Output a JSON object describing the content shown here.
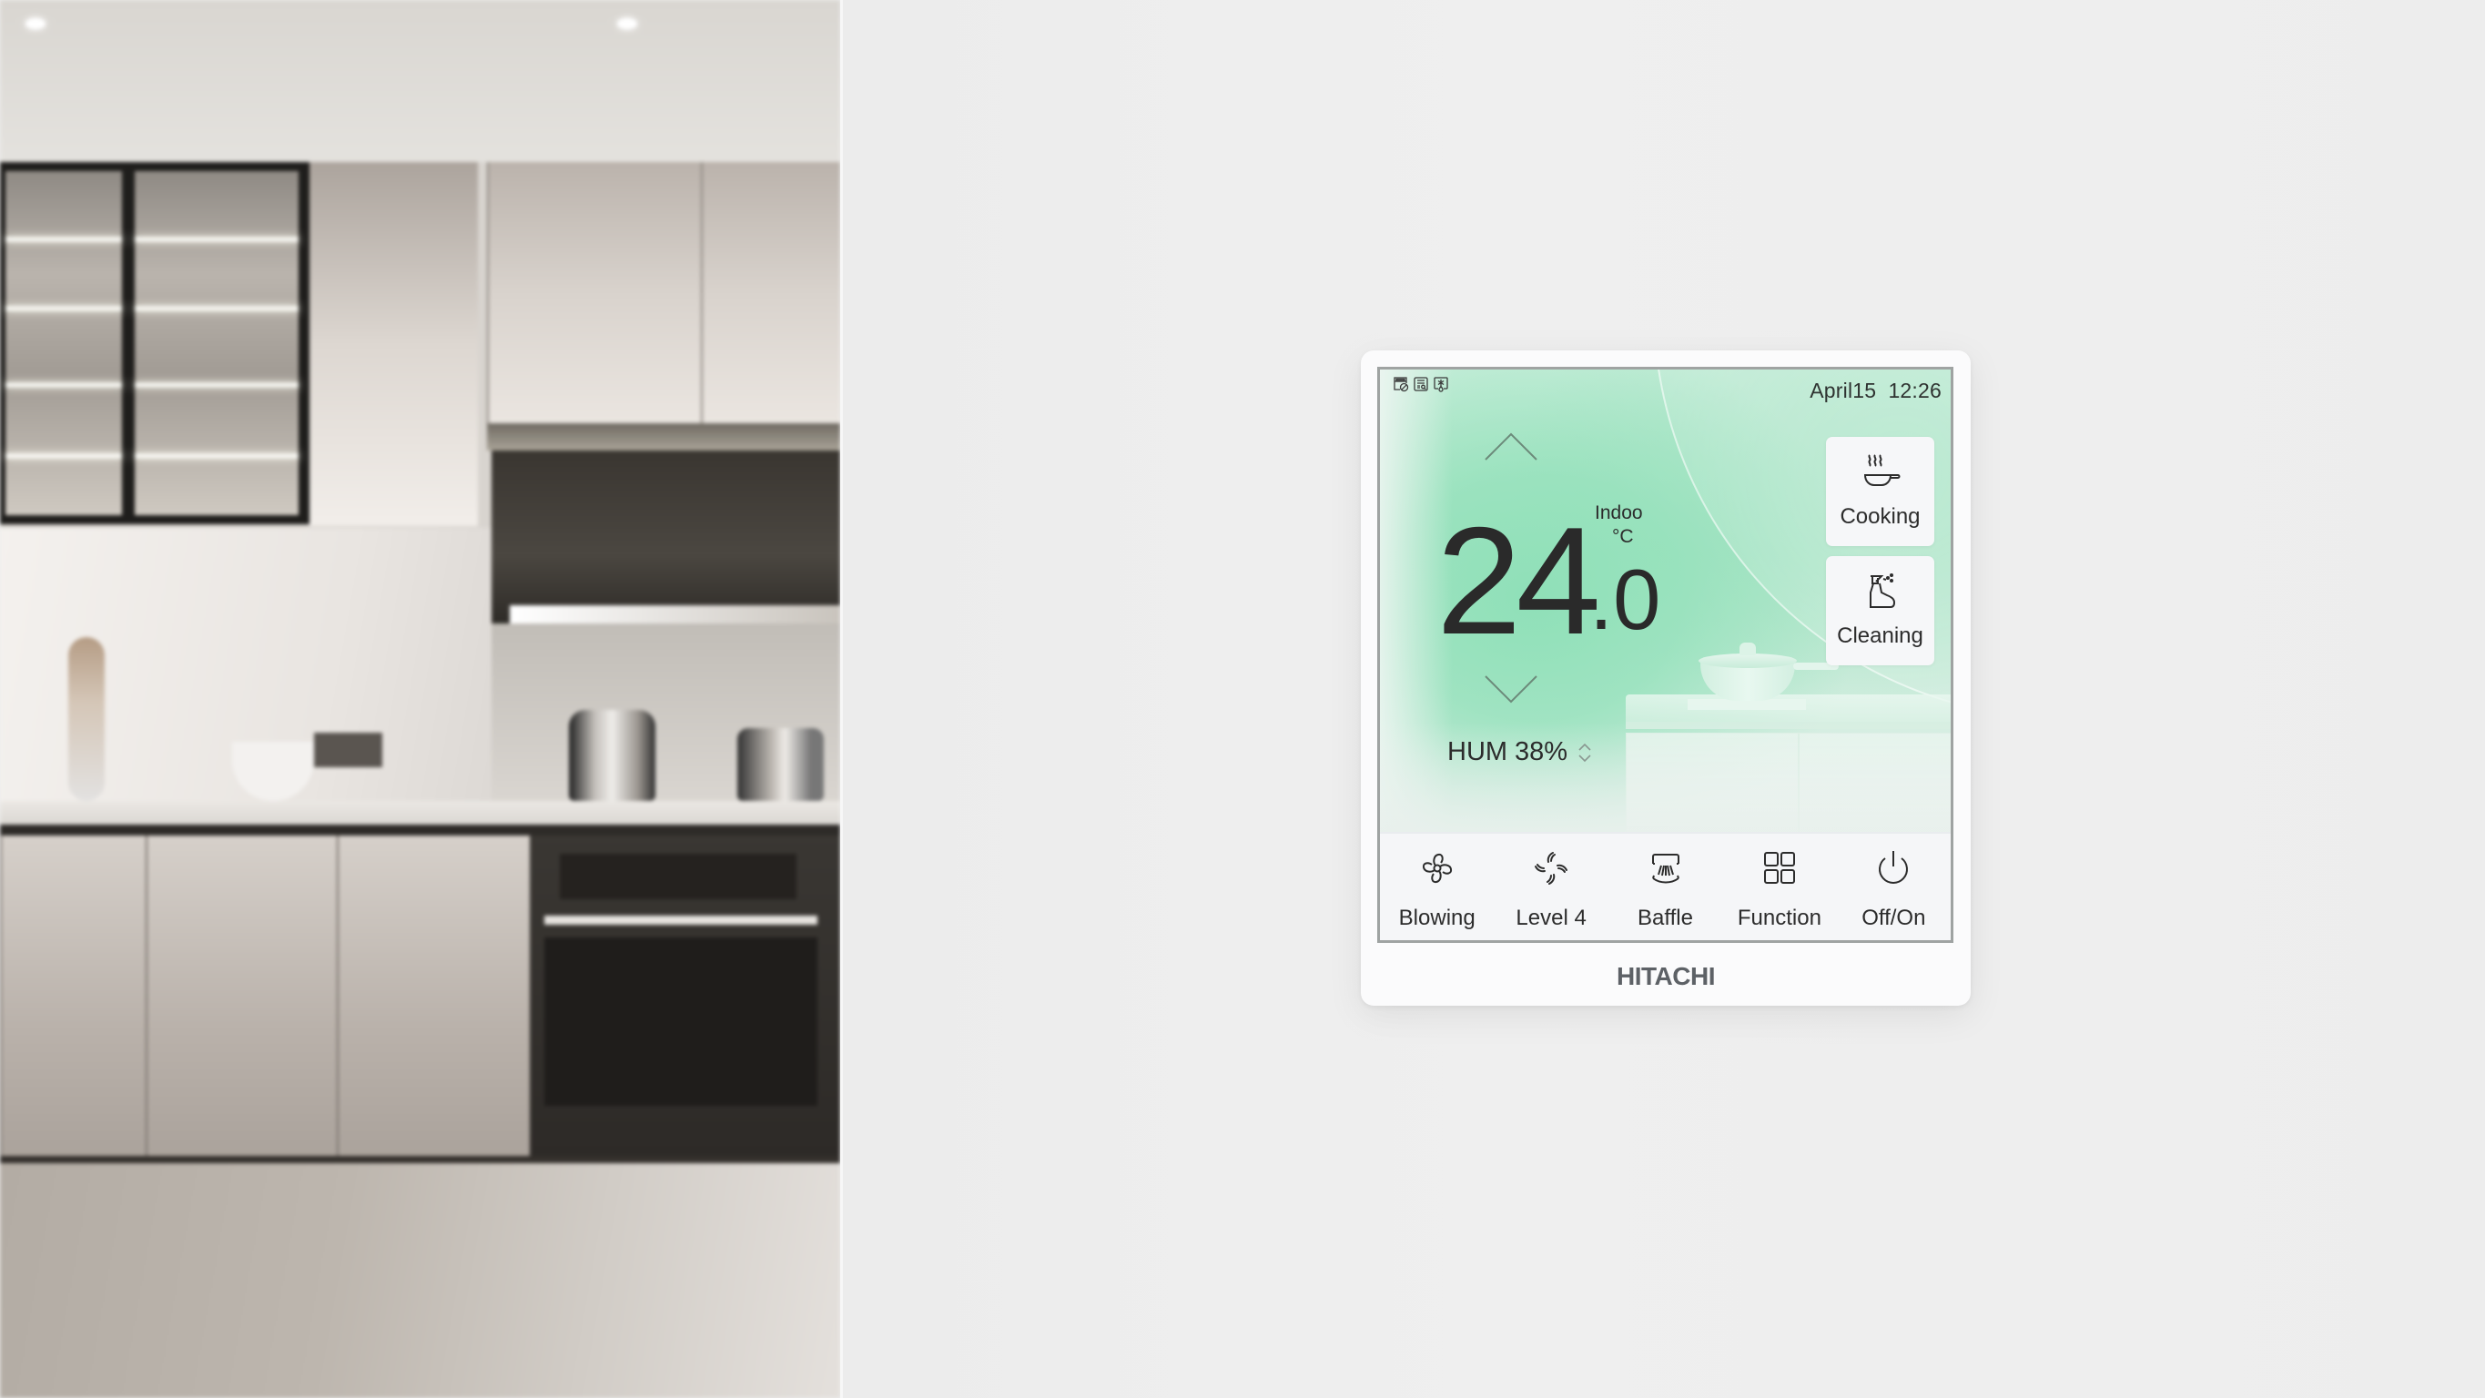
{
  "scene": {
    "background_photo": "blurred modern kitchen",
    "wall_color": "#eeeeee"
  },
  "device": {
    "brand": "HITACHI",
    "screen": {
      "status_icons": [
        {
          "name": "filter-disabled-icon"
        },
        {
          "name": "report-search-icon"
        },
        {
          "name": "defrost-icon"
        }
      ],
      "date": "April15",
      "time": "12:26",
      "temperature": {
        "integer": "24",
        "decimal": ".0",
        "label": "Indoo",
        "unit": "°C",
        "value": 24.0
      },
      "humidity": {
        "label": "HUM",
        "value": "38%"
      },
      "modes": [
        {
          "id": "cooking",
          "label": "Cooking",
          "icon": "frying-pan-steam-icon"
        },
        {
          "id": "cleaning",
          "label": "Cleaning",
          "icon": "spray-bottle-icon"
        }
      ],
      "bottom_bar": [
        {
          "id": "blowing",
          "label": "Blowing",
          "icon": "fan-icon"
        },
        {
          "id": "level",
          "label": "Level 4",
          "icon": "fan-speed-icon"
        },
        {
          "id": "baffle",
          "label": "Baffle",
          "icon": "baffle-swing-icon"
        },
        {
          "id": "function",
          "label": "Function",
          "icon": "grid-icon"
        },
        {
          "id": "power",
          "label": "Off/On",
          "icon": "power-icon"
        }
      ]
    },
    "colors": {
      "accent_green": "#8fe0b8",
      "text": "#2c2c2c",
      "logo": "#5d6166"
    }
  }
}
